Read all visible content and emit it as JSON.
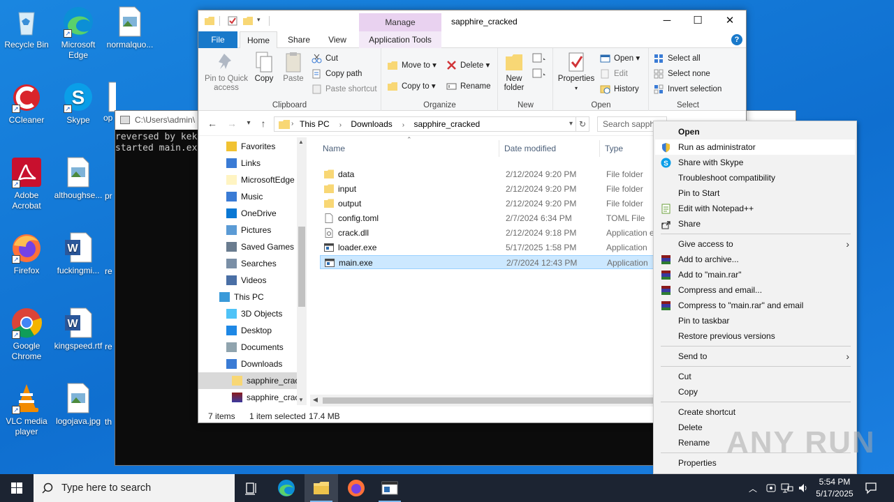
{
  "desktop": {
    "icons": [
      {
        "label": "Recycle Bin"
      },
      {
        "label": "Microsoft Edge"
      },
      {
        "label": "normalquo..."
      },
      {
        "label": "CCleaner"
      },
      {
        "label": "Skype"
      },
      {
        "label": "op"
      },
      {
        "label": "Adobe Acrobat"
      },
      {
        "label": "althoughse..."
      },
      {
        "label": "pr"
      },
      {
        "label": "Firefox"
      },
      {
        "label": "fuckingmi..."
      },
      {
        "label": "re"
      },
      {
        "label": "Google Chrome"
      },
      {
        "label": "kingspeed.rtf"
      },
      {
        "label": "re"
      },
      {
        "label": "VLC media player"
      },
      {
        "label": "logojava.jpg"
      },
      {
        "label": "th"
      }
    ]
  },
  "console": {
    "title": "C:\\Users\\admin\\",
    "lines": [
      "reversed by kek",
      "started main.ex"
    ]
  },
  "explorer": {
    "window_title": "sapphire_cracked",
    "context_tab": "Manage",
    "tabs": {
      "file": "File",
      "home": "Home",
      "share": "Share",
      "view": "View",
      "app_tools": "Application Tools"
    },
    "help": "?",
    "ribbon": {
      "clipboard": {
        "label": "Clipboard",
        "pin": "Pin to Quick access",
        "copy": "Copy",
        "paste": "Paste",
        "cut": "Cut",
        "copy_path": "Copy path",
        "paste_shortcut": "Paste shortcut"
      },
      "organize": {
        "label": "Organize",
        "move_to": "Move to",
        "copy_to": "Copy to",
        "delete": "Delete",
        "rename": "Rename"
      },
      "new": {
        "label": "New",
        "new_folder": "New folder"
      },
      "open": {
        "label": "Open",
        "properties": "Properties",
        "open": "Open",
        "edit": "Edit",
        "history": "History"
      },
      "select": {
        "label": "Select",
        "select_all": "Select all",
        "select_none": "Select none",
        "invert": "Invert selection"
      }
    },
    "address": {
      "crumbs": [
        "This PC",
        "Downloads",
        "sapphire_cracked"
      ],
      "search_placeholder": "Search sapphi"
    },
    "nav": [
      {
        "label": "Favorites",
        "indent": 1
      },
      {
        "label": "Links",
        "indent": 1
      },
      {
        "label": "MicrosoftEdge",
        "indent": 1
      },
      {
        "label": "Music",
        "indent": 1
      },
      {
        "label": "OneDrive",
        "indent": 1
      },
      {
        "label": "Pictures",
        "indent": 1
      },
      {
        "label": "Saved Games",
        "indent": 1
      },
      {
        "label": "Searches",
        "indent": 1
      },
      {
        "label": "Videos",
        "indent": 1
      },
      {
        "label": "This PC",
        "indent": 0
      },
      {
        "label": "3D Objects",
        "indent": 1
      },
      {
        "label": "Desktop",
        "indent": 1
      },
      {
        "label": "Documents",
        "indent": 1
      },
      {
        "label": "Downloads",
        "indent": 1
      },
      {
        "label": "sapphire_crac",
        "indent": 2
      },
      {
        "label": "sapphire_crac",
        "indent": 2
      }
    ],
    "columns": {
      "name": "Name",
      "date": "Date modified",
      "type": "Type"
    },
    "files": [
      {
        "name": "data",
        "date": "2/12/2024 9:20 PM",
        "type": "File folder",
        "kind": "folder"
      },
      {
        "name": "input",
        "date": "2/12/2024 9:20 PM",
        "type": "File folder",
        "kind": "folder"
      },
      {
        "name": "output",
        "date": "2/12/2024 9:20 PM",
        "type": "File folder",
        "kind": "folder"
      },
      {
        "name": "config.toml",
        "date": "2/7/2024 6:34 PM",
        "type": "TOML File",
        "kind": "doc"
      },
      {
        "name": "crack.dll",
        "date": "2/12/2024 9:18 PM",
        "type": "Application e",
        "kind": "dll"
      },
      {
        "name": "loader.exe",
        "date": "5/17/2025 1:58 PM",
        "type": "Application",
        "kind": "exe"
      },
      {
        "name": "main.exe",
        "date": "2/7/2024 12:43 PM",
        "type": "Application",
        "kind": "exe",
        "selected": true
      }
    ],
    "status": {
      "count": "7 items",
      "selection": "1 item selected",
      "size": "17.4 MB"
    }
  },
  "context_menu": {
    "items": [
      {
        "label": "Open",
        "bold": true
      },
      {
        "label": "Run as administrator",
        "icon": "shield-icon",
        "highlight": true
      },
      {
        "label": "Share with Skype",
        "icon": "skype-icon"
      },
      {
        "label": "Troubleshoot compatibility"
      },
      {
        "label": "Pin to Start"
      },
      {
        "label": "Edit with Notepad++",
        "icon": "notepadpp-icon"
      },
      {
        "label": "Share",
        "icon": "share-icon"
      },
      {
        "sep": true
      },
      {
        "label": "Give access to",
        "submenu": true
      },
      {
        "label": "Add to archive...",
        "icon": "winrar-icon"
      },
      {
        "label": "Add to \"main.rar\"",
        "icon": "winrar-icon"
      },
      {
        "label": "Compress and email...",
        "icon": "winrar-icon"
      },
      {
        "label": "Compress to \"main.rar\" and email",
        "icon": "winrar-icon"
      },
      {
        "label": "Pin to taskbar"
      },
      {
        "label": "Restore previous versions"
      },
      {
        "sep": true
      },
      {
        "label": "Send to",
        "submenu": true
      },
      {
        "sep": true
      },
      {
        "label": "Cut"
      },
      {
        "label": "Copy"
      },
      {
        "sep": true
      },
      {
        "label": "Create shortcut"
      },
      {
        "label": "Delete"
      },
      {
        "label": "Rename"
      },
      {
        "sep": true
      },
      {
        "label": "Properties"
      }
    ]
  },
  "watermark": "ANY RUN",
  "taskbar": {
    "search_placeholder": "Type here to search",
    "time": "5:54 PM",
    "date": "5/17/2025"
  },
  "colors": {
    "desktop": "#1679d8",
    "accent": "#1979ca",
    "selection": "#cce8ff",
    "taskbar": "#1c2432"
  }
}
